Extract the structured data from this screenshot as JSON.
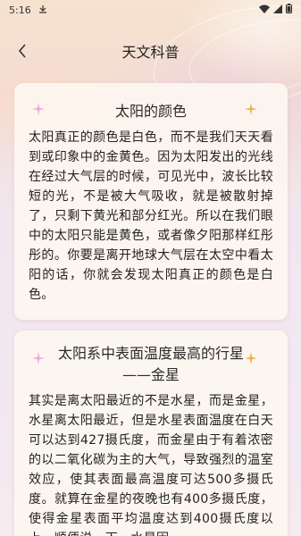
{
  "status_bar": {
    "time": "5:16"
  },
  "nav": {
    "title": "天文科普"
  },
  "cards": [
    {
      "title": "太阳的颜色",
      "body": "太阳真正的颜色是白色，而不是我们天天看到或印象中的金黄色。因为太阳发出的光线在经过大气层的时候，可见光中，波长比较短的光，不是被大气吸收，就是被散射掉了，只剩下黄光和部分红光。所以在我们眼中的太阳只能是黄色，或者像夕阳那样红彤彤的。你要是离开地球大气层在太空中看太阳的话，你就会发现太阳真正的颜色是白色。"
    },
    {
      "title": "太阳系中表面温度最高的行星——金星",
      "body": "其实是离太阳最近的不是水星，而是金星，水星离太阳最近，但是水星表面温度在白天可以达到427摄氏度，而金星由于有着浓密的以二氧化碳为主的大气，导致强烈的温室效应，使其表面最高温度可达500多摄氏度。就算在金星的夜晚也有400多摄氏度，使得金星表面平均温度达到400摄氏度以上。顺便说一下，水星因"
    }
  ],
  "colors": {
    "sparkle_pink": "#f3a8d8",
    "sparkle_gold": "#f0b24a"
  }
}
